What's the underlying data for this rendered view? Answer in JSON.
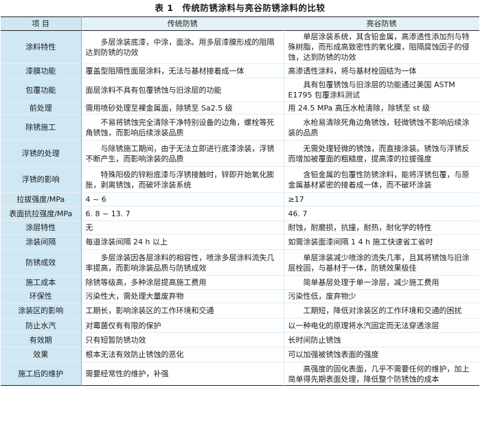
{
  "table": {
    "caption": "表 1　传统防锈涂料与亮谷防锈涂料的比较",
    "headers": [
      "项 目",
      "传统防锈",
      "亮谷防锈"
    ],
    "rows": [
      {
        "item": "涂料特性",
        "a": "多层涂装底漆，中涂，面涂。用多层漆膜形成的阻隔达到防锈的功效",
        "b": "单层涂装系统，其含铅金属，高渗透性添加剂与特殊树脂，而形成高致密性的氧化膜，阻隔腐蚀因子的侵蚀，达到防锈的功效",
        "ia": true,
        "ib": true
      },
      {
        "item": "漆膜功能",
        "a": "覆盖型阻隔性面层涂料，无法与基材接着成一体",
        "b": "高渗透性涂料，将与基材栓固结为一体",
        "ia": false,
        "ib": false
      },
      {
        "item": "包覆功能",
        "a": "面层涂料不具有包覆锈蚀与旧涂层的功能",
        "b": "具有包覆锈蚀与旧涂层的功能通过美国 ASTM E1795 包覆涂料测试",
        "ia": false,
        "ib": true
      },
      {
        "item": "前处理",
        "a": "需用喷砂处理至裸金属面，除锈至 Sa2.5 级",
        "b": "用 24.5 MPa 高压水枪清除，除锈至 st 级",
        "ia": false,
        "ib": false
      },
      {
        "item": "除锈施工",
        "a": "不易将锈蚀完全清除干净特别设备的边角，螺栓等死角锈蚀，而影响后续涂装品质",
        "b": "水枪易清除死角边角锈蚀，轻微锈蚀不影响后续涂装的品质",
        "ia": true,
        "ib": true
      },
      {
        "item": "浮锈的处理",
        "a": "与除锈施工期间，由于无法立即进行底漆涂装，浮锈不断产生，而影响涂装的品质",
        "b": "无需处理轻微的锈蚀，而直接涂装。锈蚀与浮锈反而增加被覆面的粗糙度，提高漆的拉拔强度",
        "ia": true,
        "ib": true
      },
      {
        "item": "浮锈的影响",
        "a": "特殊阳极的锌粉底漆与浮锈接触时，锌即开始氧化膨胀，剥离锈蚀，而破坏涂装系统",
        "b": "含铅金属的包覆性防锈涂料，能将浮锈包覆，与原金属基材紧密的接着成一体，而不破坏涂装",
        "ia": true,
        "ib": true
      },
      {
        "item": "拉拔强度/MPa",
        "a": "4 ~ 6",
        "b": "≥17",
        "ia": false,
        "ib": false
      },
      {
        "item": "表面抗拉强度/MPa",
        "a": "6. 8 ~ 13. 7",
        "b": "46. 7",
        "ia": false,
        "ib": false
      },
      {
        "item": "涂层特性",
        "a": "无",
        "b": "耐蚀，耐磨损，抗撞，耐热，耐化学的特性",
        "ia": false,
        "ib": false
      },
      {
        "item": "涂装间隔",
        "a": "每道涂装间隔 24 h 以上",
        "b": "如需涂装面漆间隔 1 4 h 施工快速省工省时",
        "ia": false,
        "ib": false
      },
      {
        "item": "防锈成效",
        "a": "多层涂装因各层涂料的相容性，喷涂多层涂料流失几率提高，而影响涂装品质与防锈成效",
        "b": "单层涂装减少喷涂的流失几率，且其将锈蚀与旧涂层栓固，与基材于一体，防锈效果极佳",
        "ia": true,
        "ib": true
      },
      {
        "item": "施工成本",
        "a": "除锈等级高，多种涂层提高施工费用",
        "b": "简单基层处理于单一涂层，减少施工费用",
        "ia": false,
        "ib": true
      },
      {
        "item": "环保性",
        "a": "污染性大，需处理大量废弃物",
        "b": "污染性低，废弃物少",
        "ia": false,
        "ib": false
      },
      {
        "item": "涂装区的影响",
        "a": "工期长，影响涂装区的工作环境和交通",
        "b": "工期短，降低对涂装区的工作环境和交通的困扰",
        "ia": false,
        "ib": true
      },
      {
        "item": "防止水汽",
        "a": "对霉菌仅有有限的保护",
        "b": "以一种电化的原理将水汽固定而无法穿透涂层",
        "ia": false,
        "ib": false
      },
      {
        "item": "有效期",
        "a": "只有短暂防锈功效",
        "b": "长时间防止锈蚀",
        "ia": false,
        "ib": false
      },
      {
        "item": "效果",
        "a": "根本无法有效防止锈蚀的恶化",
        "b": "可以加强被锈蚀表面的强度",
        "ia": false,
        "ib": false
      },
      {
        "item": "施工后的维护",
        "a": "需要经常性的维护，补强",
        "b": "高强度的固化表面，几乎不需要任何的维护，加上简单得先期表面处理，降低整个防锈蚀的成本",
        "ia": false,
        "ib": true
      }
    ]
  }
}
